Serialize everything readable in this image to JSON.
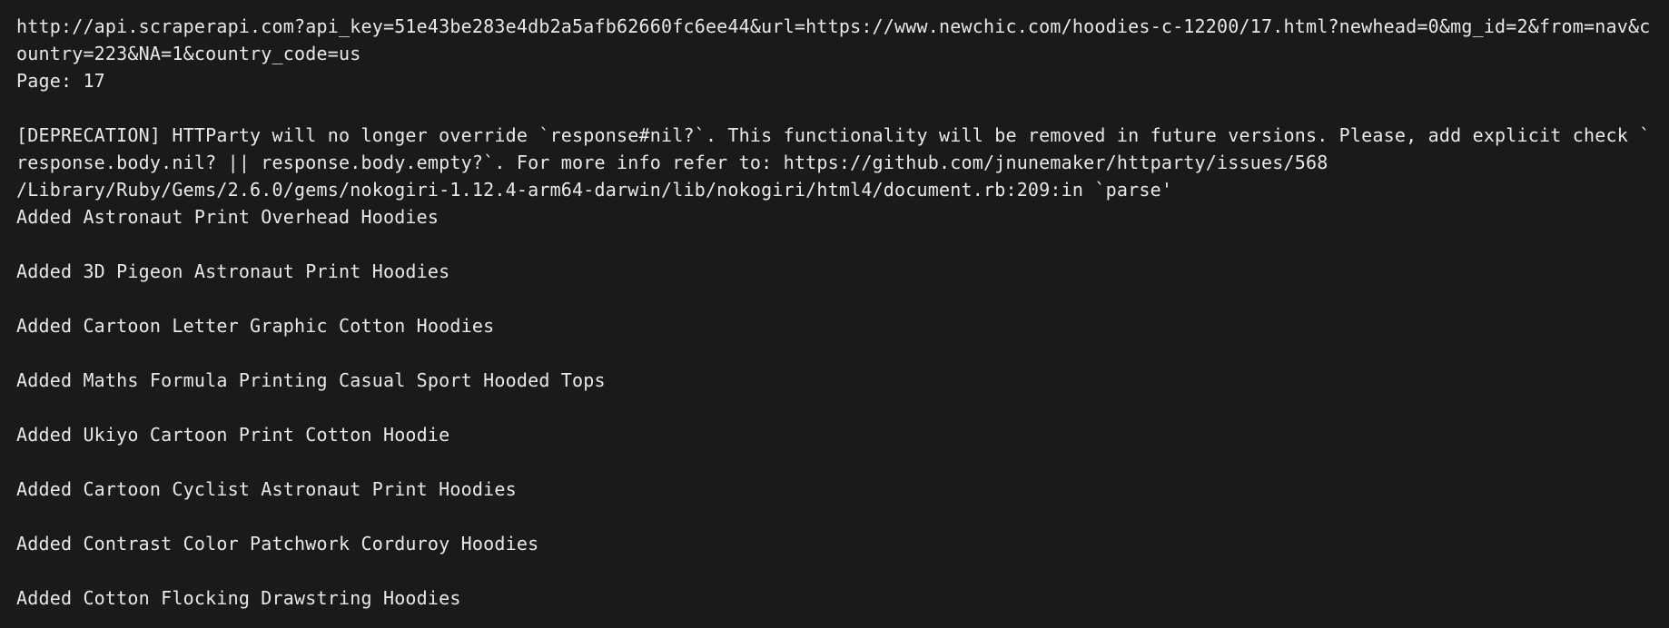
{
  "terminal": {
    "lines": [
      "http://api.scraperapi.com?api_key=51e43be283e4db2a5afb62660fc6ee44&url=https://www.newchic.com/hoodies-c-12200/17.html?newhead=0&mg_id=2&from=nav&country=223&NA=1&country_code=us",
      "Page: 17",
      "",
      "[DEPRECATION] HTTParty will no longer override `response#nil?`. This functionality will be removed in future versions. Please, add explicit check `response.body.nil? || response.body.empty?`. For more info refer to: https://github.com/jnunemaker/httparty/issues/568",
      "/Library/Ruby/Gems/2.6.0/gems/nokogiri-1.12.4-arm64-darwin/lib/nokogiri/html4/document.rb:209:in `parse'",
      "Added Astronaut Print Overhead Hoodies",
      "",
      "Added 3D Pigeon Astronaut Print Hoodies",
      "",
      "Added Cartoon Letter Graphic Cotton Hoodies",
      "",
      "Added Maths Formula Printing Casual Sport Hooded Tops",
      "",
      "Added Ukiyo Cartoon Print Cotton Hoodie",
      "",
      "Added Cartoon Cyclist Astronaut Print Hoodies",
      "",
      "Added Contrast Color Patchwork Corduroy Hoodies",
      "",
      "Added Cotton Flocking Drawstring Hoodies"
    ]
  }
}
